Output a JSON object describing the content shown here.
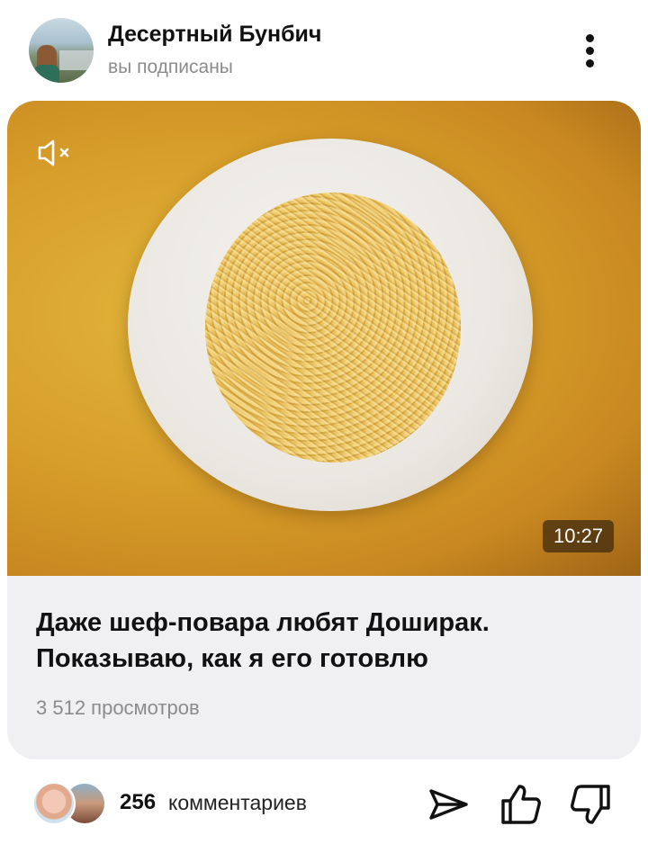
{
  "channel": {
    "name": "Десертный Бунбич",
    "status": "вы подписаны"
  },
  "video": {
    "duration": "10:27",
    "title": "Даже шеф-повара любят Доширак. Показываю, как я его готовлю",
    "views": "3 512 просмотров",
    "muted": true
  },
  "footer": {
    "comments_count": "256",
    "comments_label": "комментариев"
  },
  "icons": {
    "menu": "more-vertical-icon",
    "mute": "speaker-muted-icon",
    "share": "send-icon",
    "like": "thumbs-up-icon",
    "dislike": "thumbs-down-icon"
  }
}
